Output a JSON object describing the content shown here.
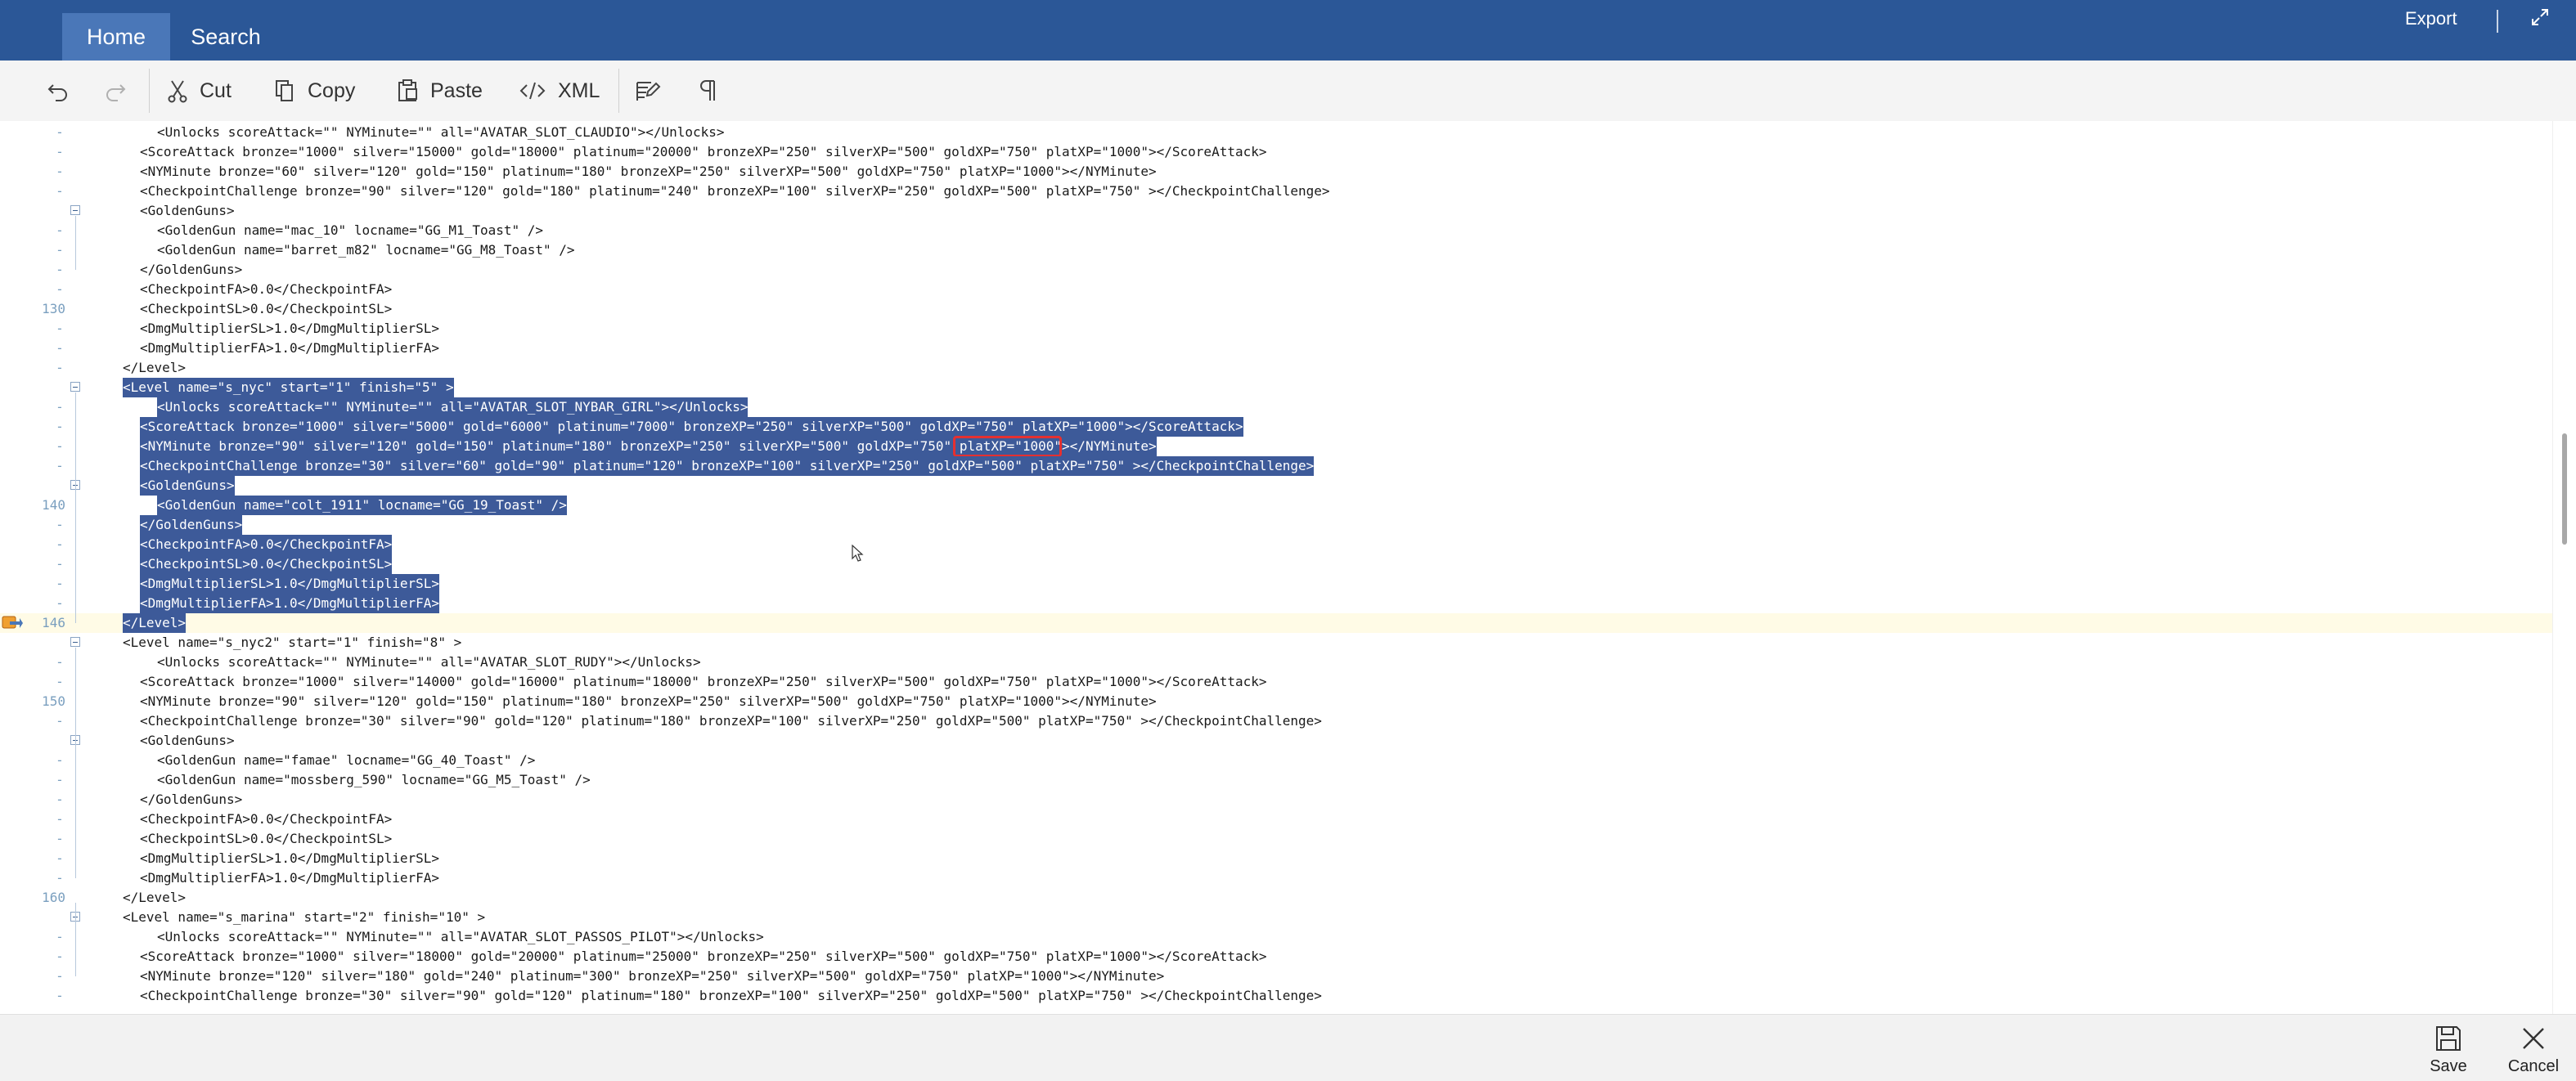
{
  "tabs": {
    "home": "Home",
    "search": "Search"
  },
  "top_right": {
    "export": "Export"
  },
  "toolbar": {
    "cut": "Cut",
    "copy": "Copy",
    "paste": "Paste",
    "xml": "XML"
  },
  "bottom": {
    "save": "Save",
    "cancel": "Cancel"
  },
  "highlighted_text": "platXP=\"1000\"",
  "colors": {
    "accent": "#2b5797",
    "selection": "#3d5a99",
    "highlight_box": "#e53030"
  },
  "editor": {
    "lines": [
      {
        "indent": 2,
        "text": "<Unlocks scoreAttack=\"\" NYMinute=\"\" all=\"AVATAR_SLOT_CLAUDIO\"></Unlocks>",
        "gutter": "-"
      },
      {
        "indent": 1,
        "text": "<ScoreAttack bronze=\"1000\" silver=\"15000\" gold=\"18000\" platinum=\"20000\" bronzeXP=\"250\" silverXP=\"500\" goldXP=\"750\" platXP=\"1000\"></ScoreAttack>",
        "gutter": "-"
      },
      {
        "indent": 1,
        "text": "<NYMinute bronze=\"60\" silver=\"120\" gold=\"150\" platinum=\"180\" bronzeXP=\"250\" silverXP=\"500\" goldXP=\"750\" platXP=\"1000\"></NYMinute>",
        "gutter": "-"
      },
      {
        "indent": 1,
        "text": "<CheckpointChallenge bronze=\"90\" silver=\"120\" gold=\"180\" platinum=\"240\" bronzeXP=\"100\" silverXP=\"250\" goldXP=\"500\" platXP=\"750\" ></CheckpointChallenge>",
        "gutter": "-"
      },
      {
        "indent": 1,
        "text": "<GoldenGuns>",
        "fold": true
      },
      {
        "indent": 2,
        "text": "<GoldenGun name=\"mac_10\" locname=\"GG_M1_Toast\" />",
        "gutter": "-"
      },
      {
        "indent": 2,
        "text": "<GoldenGun name=\"barret_m82\" locname=\"GG_M8_Toast\" />",
        "gutter": "-"
      },
      {
        "indent": 1,
        "text": "</GoldenGuns>",
        "gutter": "-"
      },
      {
        "indent": 1,
        "text": "<CheckpointFA>0.0</CheckpointFA>",
        "gutter": "-"
      },
      {
        "indent": 1,
        "text": "<CheckpointSL>0.0</CheckpointSL>",
        "ln": "130"
      },
      {
        "indent": 1,
        "text": "<DmgMultiplierSL>1.0</DmgMultiplierSL>",
        "gutter": "-"
      },
      {
        "indent": 1,
        "text": "<DmgMultiplierFA>1.0</DmgMultiplierFA>",
        "gutter": "-"
      },
      {
        "indent": 0,
        "text": "</Level>",
        "gutter": "-"
      },
      {
        "indent": 0,
        "text": "<Level name=\"s_nyc\" start=\"1\" finish=\"5\" >",
        "fold": true,
        "sel": true
      },
      {
        "indent": 2,
        "text": "<Unlocks scoreAttack=\"\" NYMinute=\"\" all=\"AVATAR_SLOT_NYBAR_GIRL\"></Unlocks>",
        "gutter": "-",
        "sel": true
      },
      {
        "indent": 1,
        "text": "<ScoreAttack bronze=\"1000\" silver=\"5000\" gold=\"6000\" platinum=\"7000\" bronzeXP=\"250\" silverXP=\"500\" goldXP=\"750\" platXP=\"1000\"></ScoreAttack>",
        "gutter": "-",
        "sel": true
      },
      {
        "indent": 1,
        "text": "<NYMinute bronze=\"90\" silver=\"120\" gold=\"150\" platinum=\"180\" bronzeXP=\"250\" silverXP=\"500\" goldXP=\"750\" platXP=\"1000\"></NYMinute>",
        "gutter": "-",
        "sel": true,
        "box": true
      },
      {
        "indent": 1,
        "text": "<CheckpointChallenge bronze=\"30\" silver=\"60\" gold=\"90\" platinum=\"120\" bronzeXP=\"100\" silverXP=\"250\" goldXP=\"500\" platXP=\"750\" ></CheckpointChallenge>",
        "gutter": "-",
        "sel": true
      },
      {
        "indent": 1,
        "text": "<GoldenGuns>",
        "fold": true,
        "sel": true
      },
      {
        "indent": 2,
        "text": "<GoldenGun name=\"colt_1911\" locname=\"GG_19_Toast\" />",
        "ln": "140",
        "sel": true
      },
      {
        "indent": 1,
        "text": "</GoldenGuns>",
        "gutter": "-",
        "sel": true
      },
      {
        "indent": 1,
        "text": "<CheckpointFA>0.0</CheckpointFA>",
        "gutter": "-",
        "sel": true
      },
      {
        "indent": 1,
        "text": "<CheckpointSL>0.0</CheckpointSL>",
        "gutter": "-",
        "sel": true
      },
      {
        "indent": 1,
        "text": "<DmgMultiplierSL>1.0</DmgMultiplierSL>",
        "gutter": "-",
        "sel": true
      },
      {
        "indent": 1,
        "text": "<DmgMultiplierFA>1.0</DmgMultiplierFA>",
        "gutter": "-",
        "sel": true
      },
      {
        "indent": 0,
        "text": "</Level>",
        "ln": "146",
        "sel": true,
        "current": true,
        "bookmark": true
      },
      {
        "indent": 0,
        "text": "<Level name=\"s_nyc2\" start=\"1\" finish=\"8\" >",
        "fold": true
      },
      {
        "indent": 2,
        "text": "<Unlocks scoreAttack=\"\" NYMinute=\"\" all=\"AVATAR_SLOT_RUDY\"></Unlocks>",
        "gutter": "-"
      },
      {
        "indent": 1,
        "text": "<ScoreAttack bronze=\"1000\" silver=\"14000\" gold=\"16000\" platinum=\"18000\" bronzeXP=\"250\" silverXP=\"500\" goldXP=\"750\" platXP=\"1000\"></ScoreAttack>",
        "gutter": "-"
      },
      {
        "indent": 1,
        "text": "<NYMinute bronze=\"90\" silver=\"120\" gold=\"150\" platinum=\"180\" bronzeXP=\"250\" silverXP=\"500\" goldXP=\"750\" platXP=\"1000\"></NYMinute>",
        "ln": "150"
      },
      {
        "indent": 1,
        "text": "<CheckpointChallenge bronze=\"30\" silver=\"90\" gold=\"120\" platinum=\"180\" bronzeXP=\"100\" silverXP=\"250\" goldXP=\"500\" platXP=\"750\" ></CheckpointChallenge>",
        "gutter": "-"
      },
      {
        "indent": 1,
        "text": "<GoldenGuns>",
        "fold": true
      },
      {
        "indent": 2,
        "text": "<GoldenGun name=\"famae\" locname=\"GG_40_Toast\" />",
        "gutter": "-"
      },
      {
        "indent": 2,
        "text": "<GoldenGun name=\"mossberg_590\" locname=\"GG_M5_Toast\" />",
        "gutter": "-"
      },
      {
        "indent": 1,
        "text": "</GoldenGuns>",
        "gutter": "-"
      },
      {
        "indent": 1,
        "text": "<CheckpointFA>0.0</CheckpointFA>",
        "gutter": "-"
      },
      {
        "indent": 1,
        "text": "<CheckpointSL>0.0</CheckpointSL>",
        "gutter": "-"
      },
      {
        "indent": 1,
        "text": "<DmgMultiplierSL>1.0</DmgMultiplierSL>",
        "gutter": "-"
      },
      {
        "indent": 1,
        "text": "<DmgMultiplierFA>1.0</DmgMultiplierFA>",
        "gutter": "-"
      },
      {
        "indent": 0,
        "text": "</Level>",
        "ln": "160"
      },
      {
        "indent": 0,
        "text": "<Level name=\"s_marina\" start=\"2\" finish=\"10\" >",
        "fold": true
      },
      {
        "indent": 2,
        "text": "<Unlocks scoreAttack=\"\" NYMinute=\"\" all=\"AVATAR_SLOT_PASSOS_PILOT\"></Unlocks>",
        "gutter": "-"
      },
      {
        "indent": 1,
        "text": "<ScoreAttack bronze=\"1000\" silver=\"18000\" gold=\"20000\" platinum=\"25000\" bronzeXP=\"250\" silverXP=\"500\" goldXP=\"750\" platXP=\"1000\"></ScoreAttack>",
        "gutter": "-"
      },
      {
        "indent": 1,
        "text": "<NYMinute bronze=\"120\" silver=\"180\" gold=\"240\" platinum=\"300\" bronzeXP=\"250\" silverXP=\"500\" goldXP=\"750\" platXP=\"1000\"></NYMinute>",
        "gutter": "-"
      },
      {
        "indent": 1,
        "text": "<CheckpointChallenge bronze=\"30\" silver=\"90\" gold=\"120\" platinum=\"180\" bronzeXP=\"100\" silverXP=\"250\" goldXP=\"500\" platXP=\"750\" ></CheckpointChallenge>",
        "gutter": "-"
      }
    ]
  }
}
